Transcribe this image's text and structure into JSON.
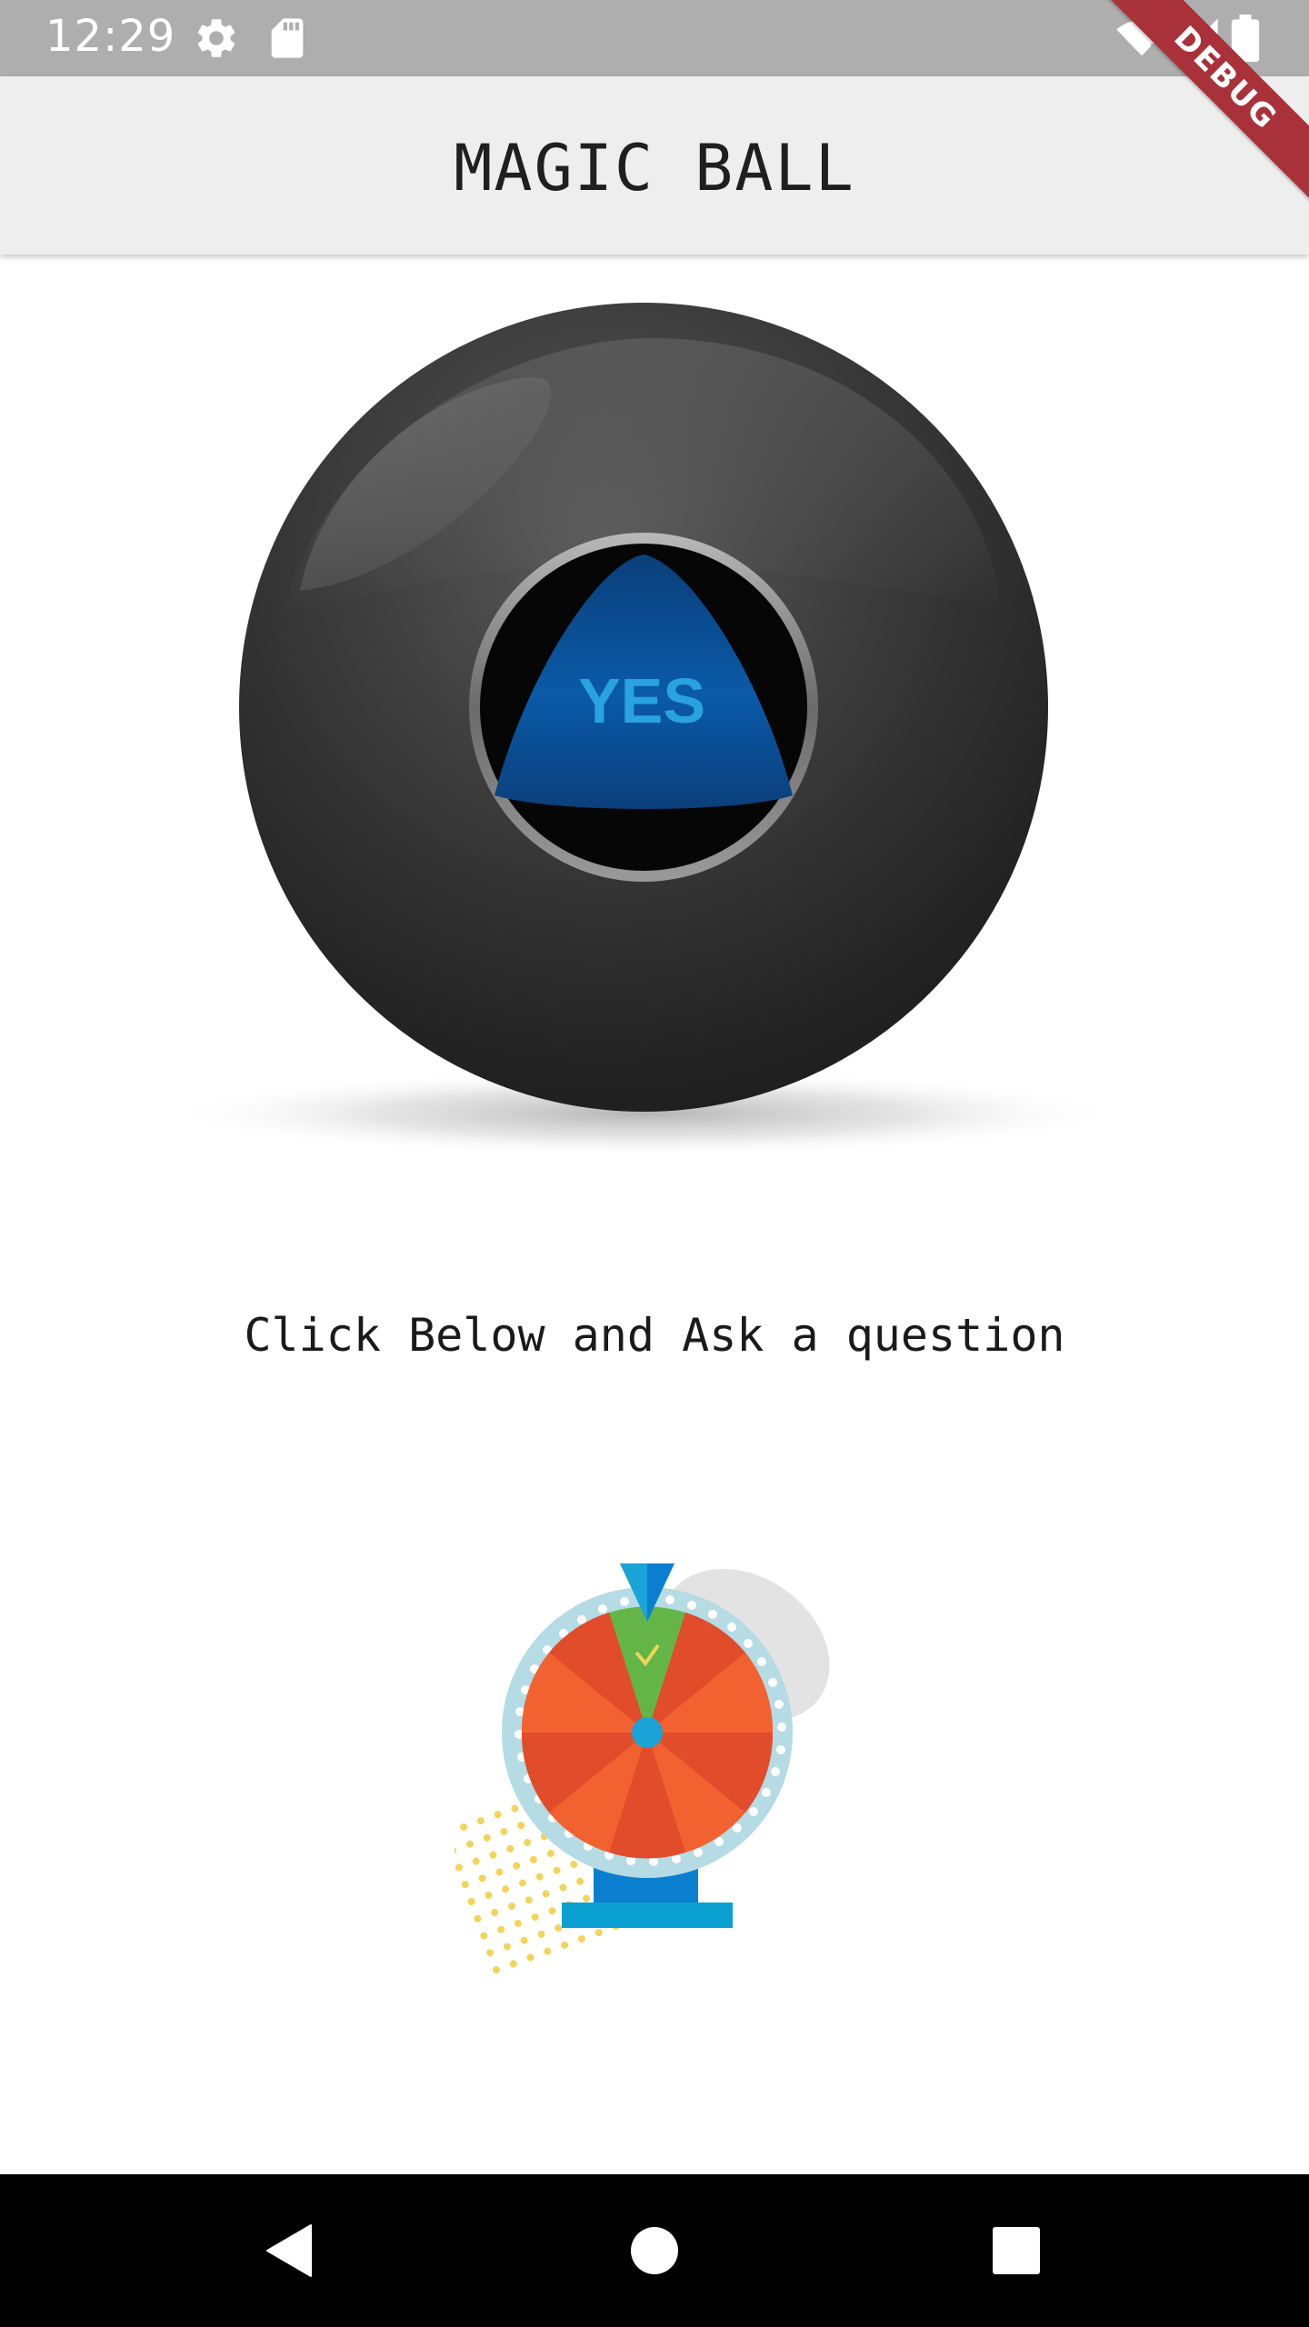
{
  "status_bar": {
    "time": "12:29"
  },
  "app_bar": {
    "title": "MAGIC BALL"
  },
  "debug_banner": {
    "label": "DEBUG"
  },
  "ball": {
    "answer": "YES"
  },
  "prompt": {
    "text": "Click Below and Ask a question"
  },
  "icons": {
    "settings": "gear-icon",
    "sd_card": "sd-card-icon",
    "wifi": "wifi-icon",
    "signal": "signal-icon",
    "battery": "battery-icon",
    "back": "back-icon",
    "home": "home-icon",
    "recents": "recents-icon"
  },
  "colors": {
    "status_bar": "#aeaeae",
    "app_bar": "#eeeeee",
    "debug_ribbon": "#a8313a",
    "answer_triangle": "#0a5aa8",
    "answer_text": "#29a3e0"
  }
}
